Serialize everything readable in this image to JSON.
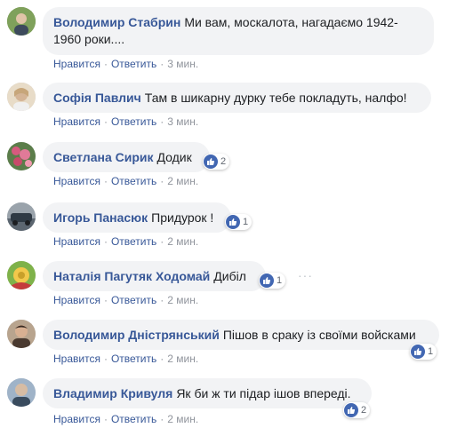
{
  "comments": [
    {
      "author": "Володимир Стабрин",
      "text_line1": "Ми вам, москалота, нагадаємо 1942-",
      "text_line2": "1960 роки....",
      "like_label": "Нравится",
      "reply_label": "Ответить",
      "time": "3 мин.",
      "avatar_color": "#6b8e4e"
    },
    {
      "author": "Софія Павлич",
      "text": "Там в шикарну дурку тебе покладуть, налфо!",
      "like_label": "Нравится",
      "reply_label": "Ответить",
      "time": "3 мин.",
      "avatar_color": "#d9c3a6"
    },
    {
      "author": "Светлана Сирик",
      "text": "Додик",
      "reactions": "2",
      "like_label": "Нравится",
      "reply_label": "Ответить",
      "time": "2 мин.",
      "avatar_color": "#b84d6e"
    },
    {
      "author": "Игорь Панасюк",
      "text": "Придурок !",
      "reactions": "1",
      "like_label": "Нравится",
      "reply_label": "Ответить",
      "time": "2 мин.",
      "avatar_color": "#8a8f94"
    },
    {
      "author": "Наталія Пагутяк Ходомай",
      "text": "Дибіл",
      "reactions": "1",
      "like_label": "Нравится",
      "reply_label": "Ответить",
      "time": "2 мин.",
      "avatar_color": "#d6b73a"
    },
    {
      "author": "Володимир Дністрянський",
      "text": "Пішов в сраку із своїми войсками",
      "reactions": "1",
      "like_label": "Нравится",
      "reply_label": "Ответить",
      "time": "2 мин.",
      "avatar_color": "#5e4a3e"
    },
    {
      "author": "Владимир Кривуля",
      "text": "Як би ж ти підар ішов впереді.",
      "reactions": "2",
      "like_label": "Нравится",
      "reply_label": "Ответить",
      "time": "2 мин.",
      "avatar_color": "#7a8fa8"
    }
  ],
  "separator": "·",
  "more_glyph": "···"
}
